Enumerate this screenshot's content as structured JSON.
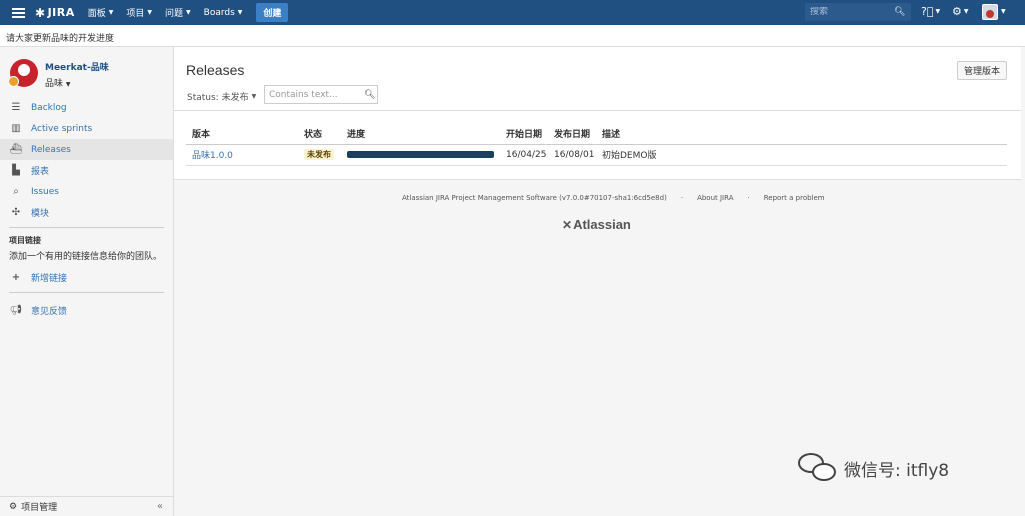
{
  "topbar": {
    "logo": "JIRA",
    "nav": [
      {
        "label": "面板"
      },
      {
        "label": "项目"
      },
      {
        "label": "问题"
      },
      {
        "label": "Boards"
      }
    ],
    "create_label": "创建",
    "search_placeholder": "搜索"
  },
  "announcement": "请大家更新品味的开发进度",
  "sidebar": {
    "project_name": "Meerkat-品味",
    "project_sub": "品味",
    "items": [
      {
        "label": "Backlog",
        "icon": "backlog-icon"
      },
      {
        "label": "Active sprints",
        "icon": "board-icon"
      },
      {
        "label": "Releases",
        "icon": "ship-icon"
      },
      {
        "label": "报表",
        "icon": "chart-icon"
      },
      {
        "label": "Issues",
        "icon": "issues-icon"
      },
      {
        "label": "模块",
        "icon": "puzzle-icon"
      }
    ],
    "links_heading": "项目链接",
    "links_desc": "添加一个有用的链接信息给你的团队。",
    "add_link_label": "新增链接",
    "feedback_label": "意见反馈",
    "footer_label": "项目管理"
  },
  "main": {
    "title": "Releases",
    "manage_label": "管理版本",
    "status_filter": "Status: 未发布",
    "filter_placeholder": "Contains text...",
    "columns": [
      "版本",
      "状态",
      "进度",
      "开始日期",
      "发布日期",
      "描述"
    ],
    "rows": [
      {
        "version": "品味1.0.0",
        "status": "未发布",
        "progress": 1.0,
        "start_date": "16/04/25",
        "release_date": "16/08/01",
        "description": "初始DEMO版"
      }
    ]
  },
  "footer": {
    "software": "Atlassian JIRA Project Management Software (v7.0.0#70107-sha1:6cd5e8d)",
    "about": "About JIRA",
    "report": "Report a problem",
    "brand": "Atlassian"
  },
  "watermark": "微信号: itfly8",
  "colors": {
    "topbar": "#205081",
    "create_button": "#3b7fc4",
    "link": "#3572b0",
    "progress_fill": "#1c3f5f",
    "lozenge_bg": "#fdf3d0",
    "project_avatar": "#c8232c"
  }
}
